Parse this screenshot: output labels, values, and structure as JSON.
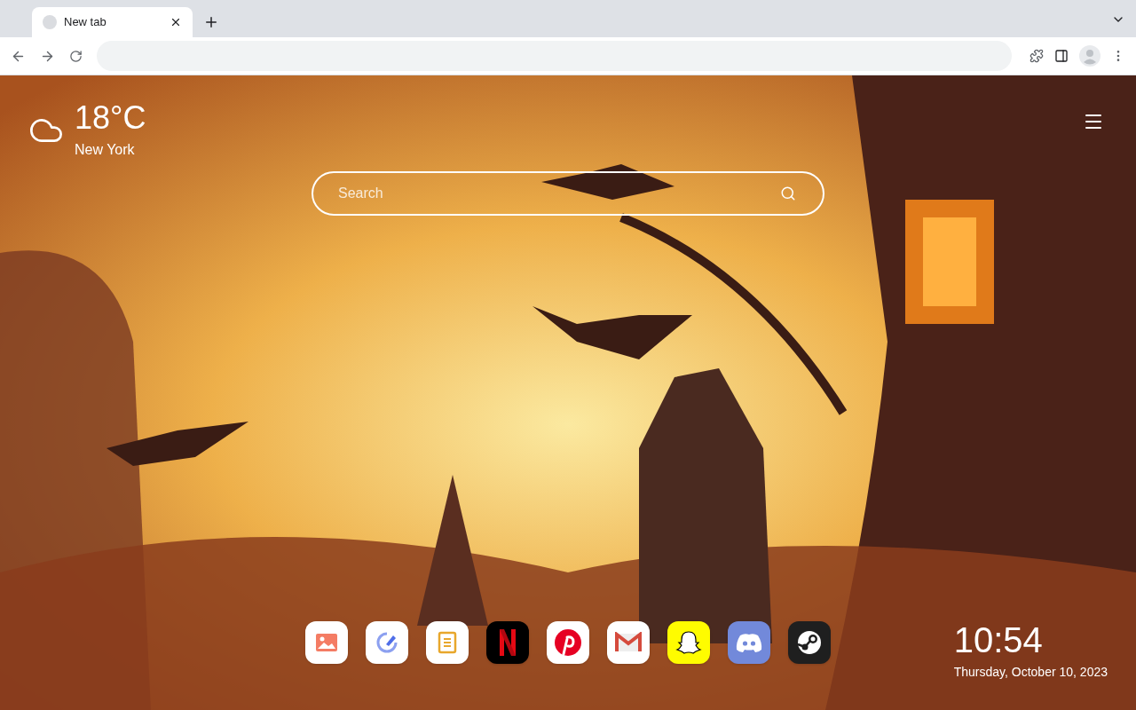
{
  "tabs": [
    {
      "title": "New tab",
      "selected": true
    }
  ],
  "weather": {
    "temperature": "18°C",
    "city": "New York"
  },
  "search": {
    "placeholder": "Search"
  },
  "shortcuts": [
    {
      "kind": "gallery"
    },
    {
      "kind": "edit"
    },
    {
      "kind": "notes"
    },
    {
      "kind": "netflix"
    },
    {
      "kind": "pinterest"
    },
    {
      "kind": "gmail"
    },
    {
      "kind": "snapchat"
    },
    {
      "kind": "discord"
    },
    {
      "kind": "steam"
    }
  ],
  "clock": {
    "time": "10:54",
    "date": "Thursday, October 10, 2023"
  }
}
